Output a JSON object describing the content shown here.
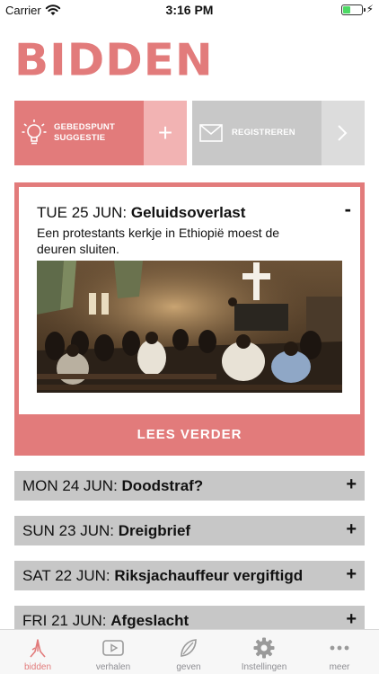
{
  "status": {
    "carrier": "Carrier",
    "time": "3:16 PM"
  },
  "app": {
    "logo": "BIDDEN"
  },
  "actions": {
    "suggest_label_line1": "GEBEDSPUNT",
    "suggest_label_line2": "SUGGESTIE",
    "suggest_plus": "+",
    "register_label": "REGISTREREN"
  },
  "featured": {
    "date": "TUE 25 JUN:",
    "title": "Geluidsoverlast",
    "collapse": "-",
    "description": "Een protestants kerkje in Ethiopië moest de deuren sluiten.",
    "read_more": "LEES VERDER"
  },
  "items": [
    {
      "date": "MON 24 JUN:",
      "title": "Doodstraf?",
      "toggle": "+"
    },
    {
      "date": "SUN 23 JUN:",
      "title": "Dreigbrief",
      "toggle": "+"
    },
    {
      "date": "SAT 22 JUN:",
      "title": "Riksjachauffeur vergiftigd",
      "toggle": "+"
    },
    {
      "date": "FRI 21 JUN:",
      "title": "Afgeslacht",
      "toggle": "+"
    }
  ],
  "tabs": [
    {
      "label": "bidden",
      "icon": "praying-hands-icon",
      "active": true
    },
    {
      "label": "verhalen",
      "icon": "play-video-icon",
      "active": false
    },
    {
      "label": "geven",
      "icon": "hand-leaf-icon",
      "active": false
    },
    {
      "label": "Instellingen",
      "icon": "gear-icon",
      "active": false
    },
    {
      "label": "meer",
      "icon": "more-dots-icon",
      "active": false
    }
  ],
  "colors": {
    "accent": "#e27b7b",
    "accent_light": "#f2b3b3",
    "gray": "#c7c7c7",
    "gray_light": "#dcdcdc",
    "battery": "#4cd964"
  }
}
